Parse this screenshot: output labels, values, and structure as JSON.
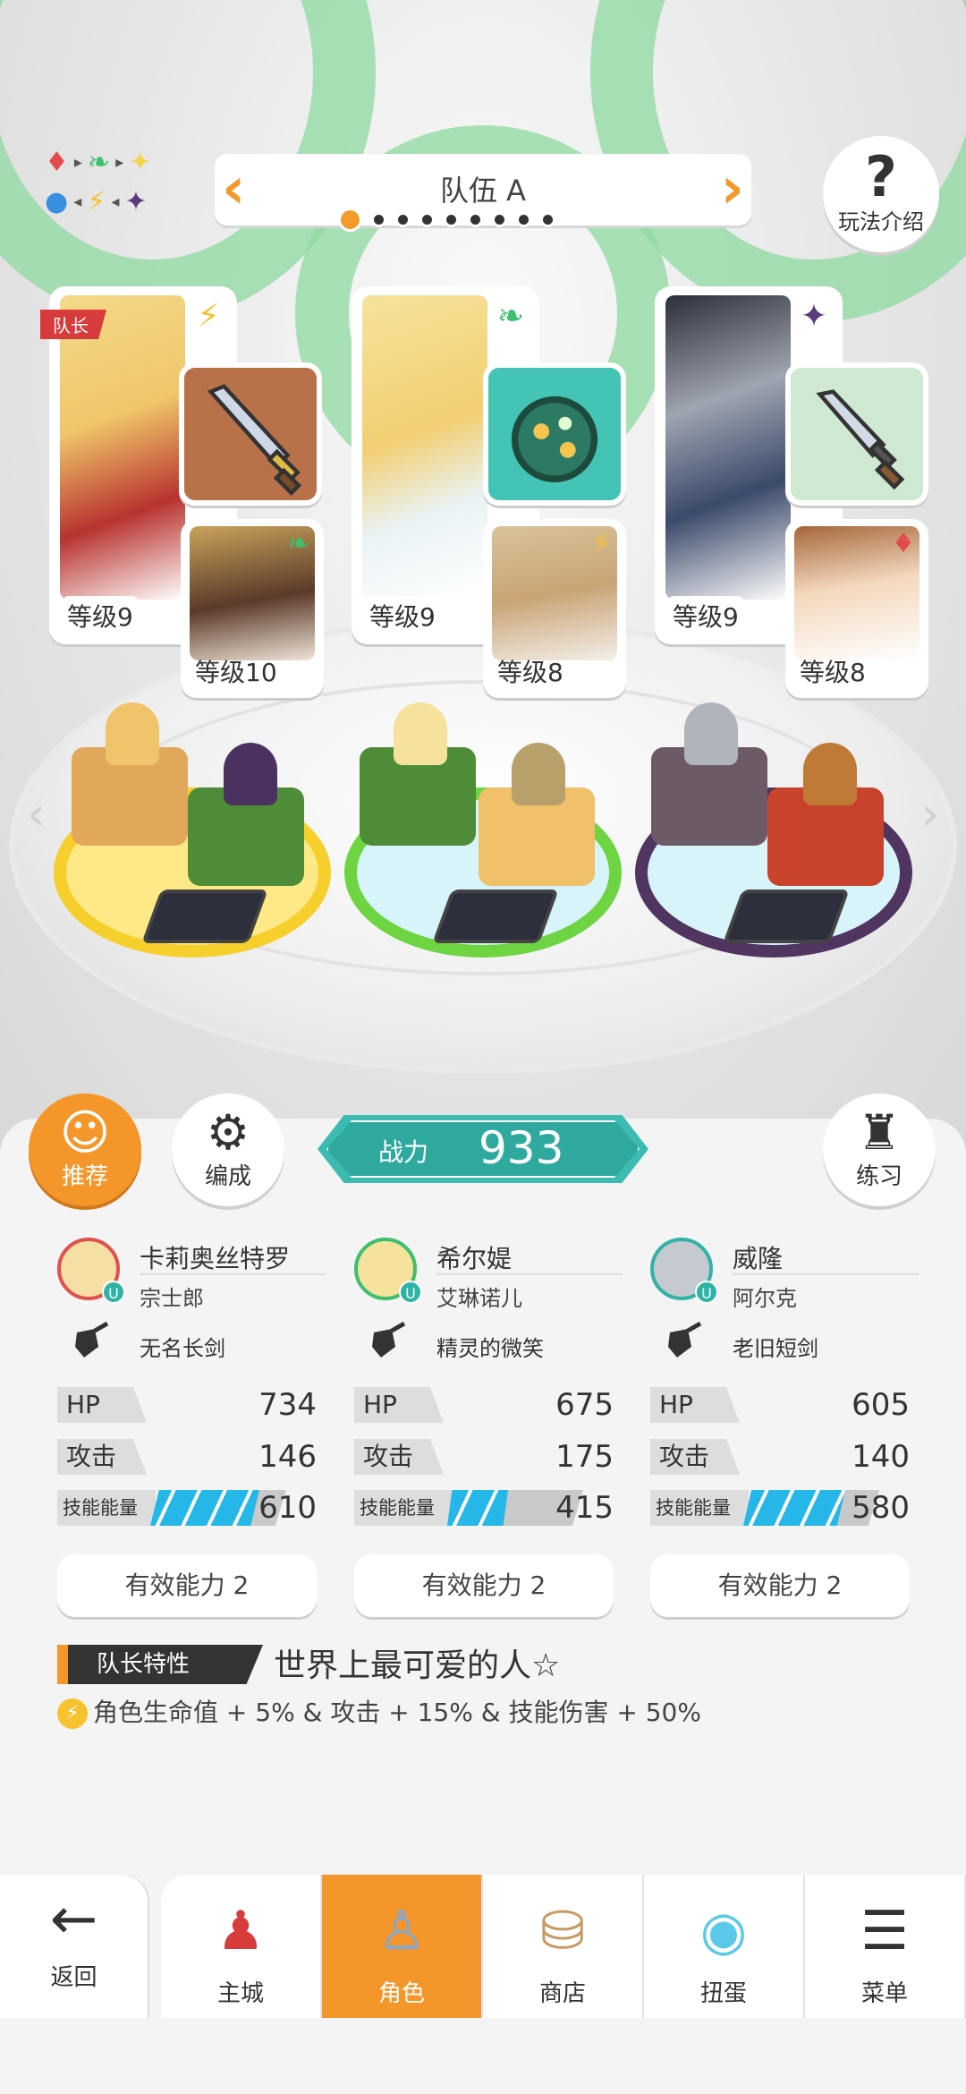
{
  "header": {
    "team_name": "队伍 A",
    "dots_total": 9,
    "dots_active": 0,
    "help_label": "玩法介绍"
  },
  "element_legend": {
    "row1": [
      "♦",
      "▸",
      "❧",
      "▸",
      "✦"
    ],
    "row2": [
      "●",
      "◂",
      "⚡",
      "◂",
      "✦"
    ]
  },
  "team": {
    "captain_tag": "队长",
    "members": [
      {
        "main_level": "等级9",
        "main_element_icon": "lightning-icon",
        "sub_level": "等级10",
        "sub_element_icon": "leaf-icon"
      },
      {
        "main_level": "等级9",
        "main_element_icon": "leaf-icon",
        "sub_level": "等级8",
        "sub_element_icon": "lightning-icon"
      },
      {
        "main_level": "等级9",
        "main_element_icon": "dark-star-icon",
        "sub_level": "等级8",
        "sub_element_icon": "fire-diamond-icon"
      }
    ]
  },
  "actions": {
    "recommend": "推荐",
    "formation": "编成",
    "practice": "练习"
  },
  "power": {
    "label": "战力",
    "value": "933"
  },
  "characters": [
    {
      "name": "卡莉奥丝特罗",
      "weapon": "宗士郎",
      "skill": "无名长剑",
      "hp_label": "HP",
      "hp": "734",
      "atk_label": "攻击",
      "atk": "146",
      "energy_label": "技能能量",
      "energy": "610",
      "energy_fill": 0.8,
      "effective": "有效能力 2",
      "ring_color": "#e0504f"
    },
    {
      "name": "希尔媞",
      "weapon": "艾琳诺儿",
      "skill": "精灵的微笑",
      "hp_label": "HP",
      "hp": "675",
      "atk_label": "攻击",
      "atk": "175",
      "energy_label": "技能能量",
      "energy": "415",
      "energy_fill": 0.45,
      "effective": "有效能力 2",
      "ring_color": "#3dbf6f"
    },
    {
      "name": "威隆",
      "weapon": "阿尔克",
      "skill": "老旧短剑",
      "hp_label": "HP",
      "hp": "605",
      "atk_label": "攻击",
      "atk": "140",
      "energy_label": "技能能量",
      "energy": "580",
      "energy_fill": 0.75,
      "effective": "有效能力 2",
      "ring_color": "#2fb3a7"
    }
  ],
  "leader": {
    "label": "队长特性",
    "name": "世界上最可爱的人☆",
    "desc": "角色生命值 + 5% & 攻击 + 15% & 技能伤害 + 50%"
  },
  "nav": {
    "back": "返回",
    "tabs": [
      "主城",
      "角色",
      "商店",
      "扭蛋",
      "菜单"
    ],
    "active_tab": "角色"
  }
}
